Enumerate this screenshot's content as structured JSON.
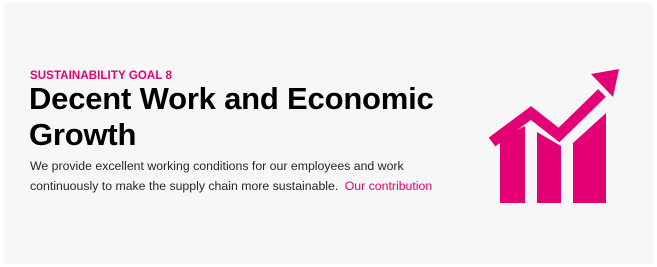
{
  "goal": {
    "eyebrow": "SUSTAINABILITY GOAL 8",
    "title": "Decent Work and Economic Growth",
    "description": "We provide excellent working conditions for our employees and work continuously to make the supply chain more sustainable.",
    "link_label": "Our contribution",
    "icon": "growth-chart-icon"
  },
  "colors": {
    "accent": "#e20074",
    "background": "#f7f7f8",
    "title": "#000000",
    "text": "#262626"
  }
}
